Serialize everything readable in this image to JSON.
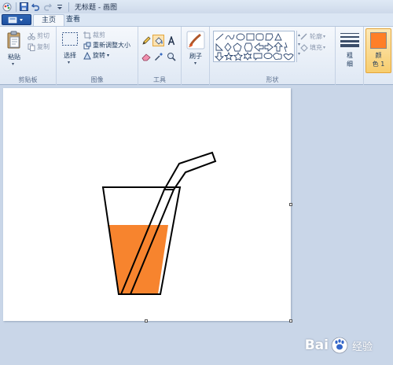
{
  "window": {
    "title": "无标题 - 画图"
  },
  "tabs": [
    {
      "label": "主页",
      "active": true
    },
    {
      "label": "查看",
      "active": false
    }
  ],
  "ribbon": {
    "clipboard": {
      "paste_label": "粘贴",
      "cut_label": "剪切",
      "copy_label": "复制",
      "group_label": "剪贴板"
    },
    "image": {
      "select_label": "选择",
      "crop_label": "裁剪",
      "resize_label": "重新调整大小",
      "rotate_label": "旋转",
      "group_label": "图像"
    },
    "tools": {
      "group_label": "工具",
      "selected_tool": "fill-bucket"
    },
    "brushes": {
      "label": "刷子"
    },
    "shapes": {
      "outline_label": "轮廓",
      "fill_label": "填充",
      "group_label": "形状"
    },
    "size": {
      "label_line1": "粗",
      "label_line2": "细"
    },
    "color1": {
      "label_line1": "颜",
      "label_line2": "色 1",
      "color": "#ff7f27"
    }
  },
  "canvas": {
    "background": "#ffffff",
    "drawing": {
      "liquid_color": "#f7842e",
      "stroke_color": "#000000"
    }
  },
  "watermark": {
    "text_left": "Bai",
    "text_right": "经验"
  }
}
